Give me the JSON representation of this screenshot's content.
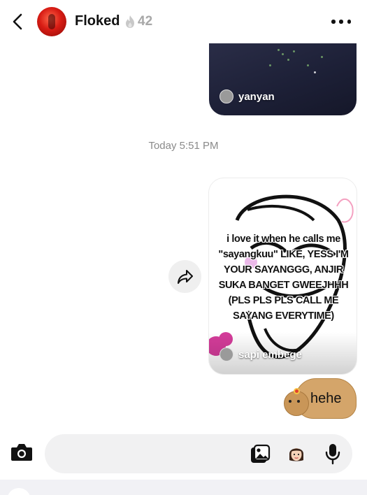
{
  "header": {
    "contact_name": "Floked",
    "streak_count": "42",
    "icons": [
      "chevron-left-icon",
      "fire-icon",
      "more-horizontal-icon"
    ]
  },
  "messages": {
    "reel_1": {
      "author": "yanyan"
    },
    "timestamp": "Today 5:51 PM",
    "reel_2": {
      "author": "sapi embege",
      "caption": "i love it when he calls me \"sayangkuu\" LIKE, YESS I'M YOUR SAYANGGG, ANJIR SUKA BANGET GWEEJHHH (PLS PLS PLS CALL ME SAYANG EVERYTIME)"
    },
    "sticker_text": "hehe"
  },
  "composer": {
    "placeholder": "",
    "icons": [
      "camera-icon",
      "gallery-icon",
      "memoji-icon",
      "microphone-icon"
    ]
  },
  "colors": {
    "streak_gray": "#a8a8a8",
    "input_bg": "#f1f1f2",
    "timestamp_gray": "#8a8a8a"
  }
}
